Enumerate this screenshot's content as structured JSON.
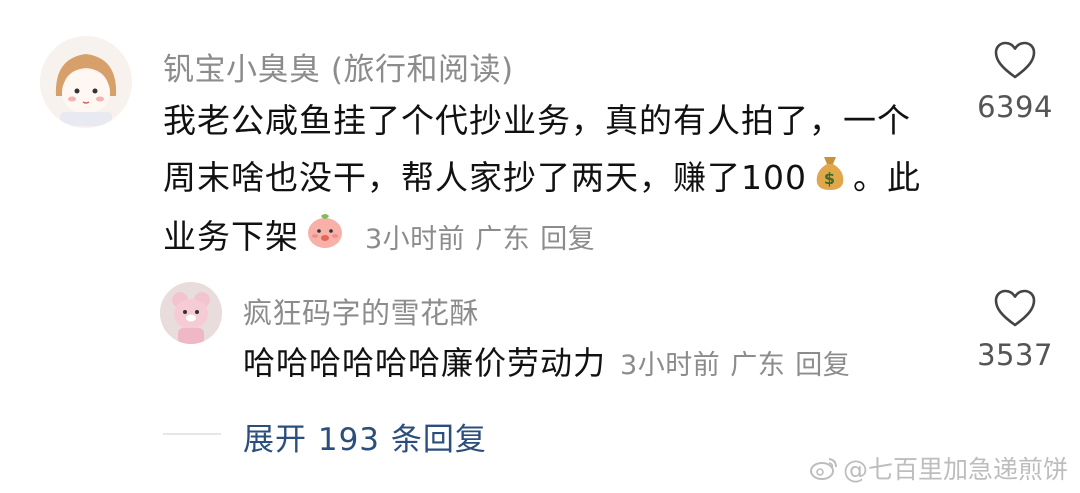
{
  "comment": {
    "username": "钒宝小臭臭 (旅行和阅读)",
    "text_lines": [
      "我老公咸鱼挂了个代抄业务，真的有人拍了，一个",
      "周末啥也没干，帮人家抄了两天，赚了100",
      "。此",
      "业务下架"
    ],
    "meta": {
      "time": "3小时前",
      "location": "广东",
      "reply": "回复"
    },
    "likes": "6394",
    "emojis": [
      "money-bag-icon",
      "peach-emoji-icon"
    ]
  },
  "reply": {
    "username": "疯狂码字的雪花酥",
    "text": "哈哈哈哈哈哈廉价劳动力",
    "meta": {
      "time": "3小时前",
      "location": "广东",
      "reply": "回复"
    },
    "likes": "3537"
  },
  "expand": {
    "label": "展开 193 条回复"
  },
  "watermark": {
    "text": "@七百里加急递煎饼",
    "icon": "weibo-icon"
  },
  "colors": {
    "text": "#111111",
    "meta": "#8c8c8c",
    "link": "#2b4f7c",
    "watermark": "#bdbdbd"
  }
}
